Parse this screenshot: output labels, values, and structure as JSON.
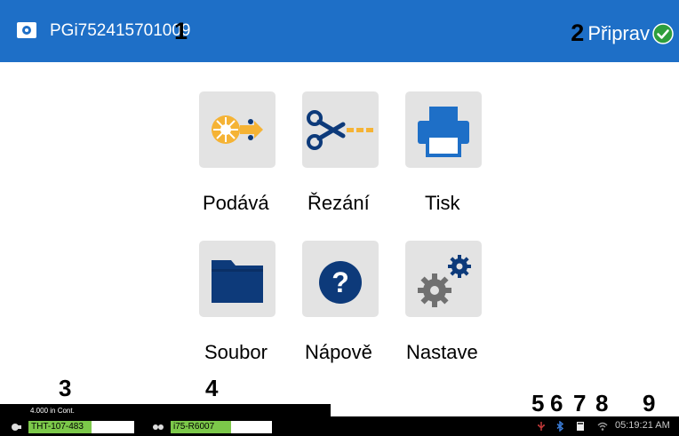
{
  "header": {
    "printer_id": "PGi752415701009",
    "callout_1": "1",
    "callout_2": "2",
    "status_text": "Připrav",
    "status_icon": "check-circle-icon"
  },
  "tiles": {
    "feed": {
      "label": "Podává",
      "icon": "feed-reel-icon"
    },
    "cut": {
      "label": "Řezání",
      "icon": "scissors-icon"
    },
    "print": {
      "label": "Tisk",
      "icon": "printer-icon"
    },
    "file": {
      "label": "Soubor",
      "icon": "folder-icon"
    },
    "help": {
      "label": "Nápově",
      "icon": "question-icon"
    },
    "settings": {
      "label": "Nastave",
      "icon": "gears-icon"
    }
  },
  "callouts": {
    "c3": "3",
    "c4": "4",
    "c5": "5",
    "c6": "6",
    "c7": "7",
    "c8": "8",
    "c9": "9"
  },
  "statusbar": {
    "label_supply": {
      "caption": "4.000 in Cont.",
      "part": "THT-107-483",
      "remaining_fraction": 0.6
    },
    "ribbon_supply": {
      "part": "i75-R6007",
      "remaining_fraction": 0.6
    },
    "icons": [
      "usb-icon",
      "bluetooth-icon",
      "sd-card-icon",
      "wifi-icon"
    ],
    "time": "05:19:21 AM"
  },
  "colors": {
    "header_bg": "#1e6fc7",
    "accent_yellow": "#f5b335",
    "navy": "#0d3a7a",
    "gear_gray": "#707070",
    "supply_green": "#7cc84a",
    "ready_green": "#2e9e3c"
  }
}
